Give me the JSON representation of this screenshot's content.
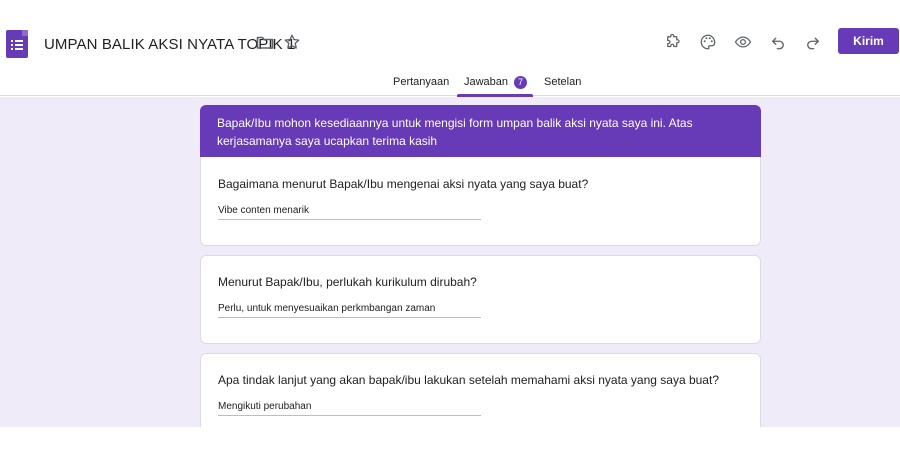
{
  "header": {
    "form_title": "UMPAN BALIK AKSI NYATA TOPIK 1",
    "send_label": "Kirim",
    "icons": [
      "folder-icon",
      "star-icon",
      "addon-icon",
      "palette-icon",
      "preview-icon",
      "undo-icon",
      "redo-icon"
    ]
  },
  "tabs": [
    {
      "label": "Pertanyaan"
    },
    {
      "label": "Jawaban",
      "badge": "7",
      "active": true
    },
    {
      "label": "Setelan"
    }
  ],
  "description": "Bapak/Ibu mohon kesediaannya untuk mengisi form umpan balik aksi nyata saya ini. Atas kerjasamanya saya ucapkan terima kasih",
  "questions": [
    {
      "question": "Bagaimana menurut Bapak/Ibu mengenai aksi nyata yang saya buat?",
      "answer": "Vibe conten menarik"
    },
    {
      "question": "Menurut Bapak/Ibu, perlukah kurikulum dirubah?",
      "answer": "Perlu, untuk menyesuaikan perkmbangan zaman"
    },
    {
      "question": "Apa tindak lanjut yang akan bapak/ibu lakukan setelah memahami aksi nyata yang saya buat?",
      "answer": "Mengikuti perubahan"
    }
  ],
  "colors": {
    "accent": "#673ab7",
    "background": "#f0ebf8"
  }
}
